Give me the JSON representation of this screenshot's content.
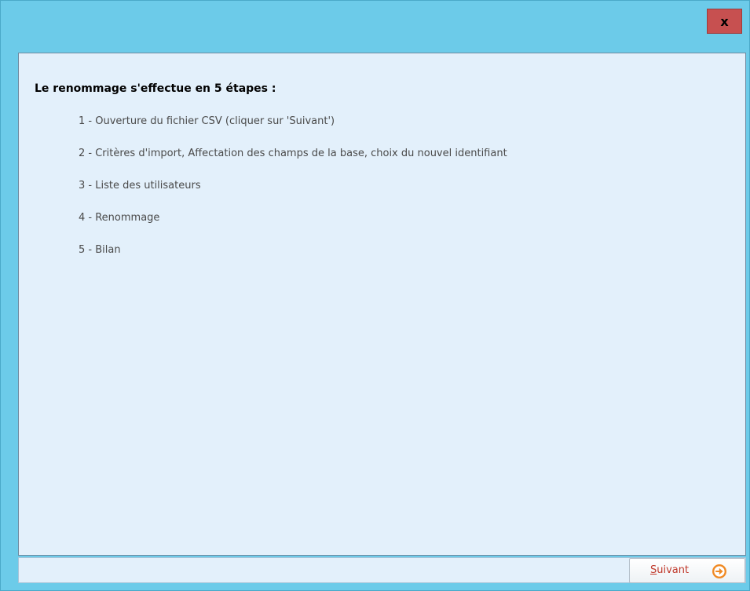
{
  "window": {
    "close_label": "x"
  },
  "main": {
    "heading": "Le renommage s'effectue en 5 étapes :",
    "steps": [
      "1 - Ouverture du fichier CSV (cliquer sur 'Suivant')",
      "2 - Critères d'import, Affectation des champs de la base, choix du nouvel identifiant",
      "3 - Liste des utilisateurs",
      "4 - Renommage",
      "5 - Bilan"
    ]
  },
  "footer": {
    "next_button": {
      "label_first": "S",
      "label_rest": "uivant",
      "icon": "arrow-right-circle-icon",
      "icon_color": "#f08a24"
    }
  },
  "colors": {
    "titlebar": "#6ccbe9",
    "close_button": "#c75050",
    "panel_background": "#e3f0fb"
  }
}
